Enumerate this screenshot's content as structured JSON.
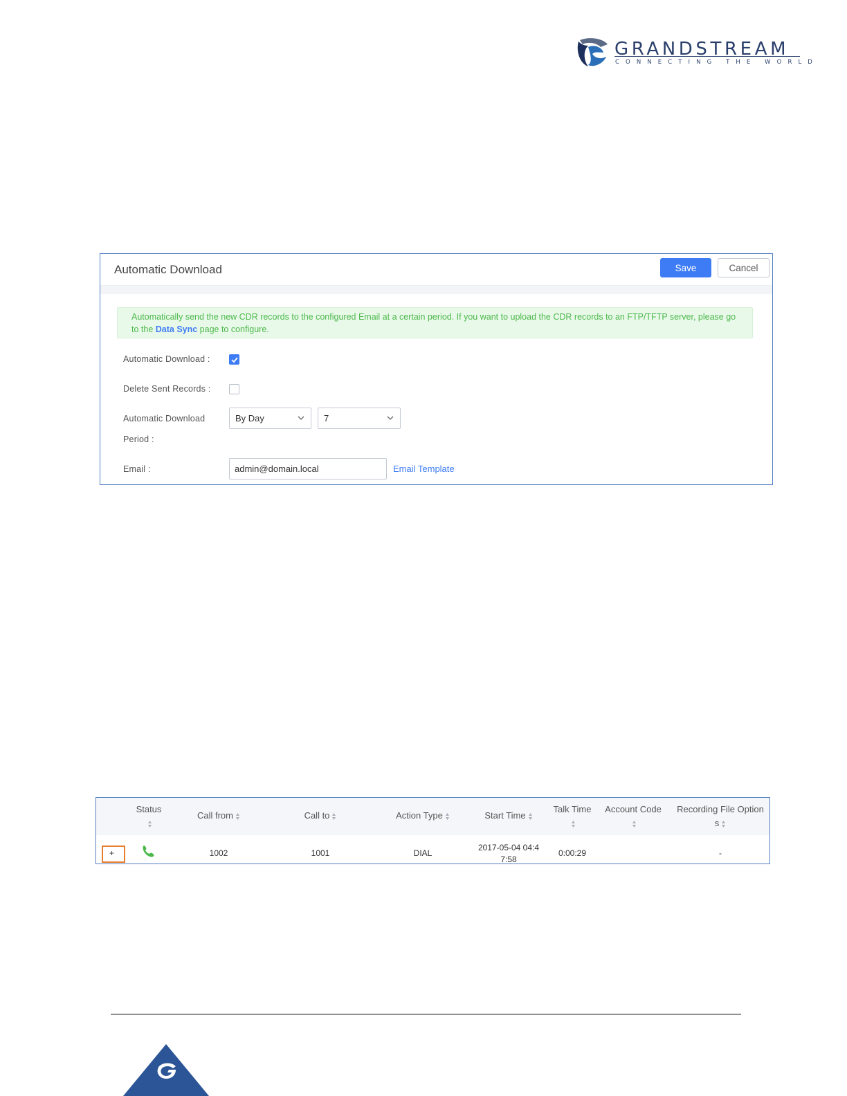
{
  "brand": {
    "name": "GRANDSTREAM",
    "tagline": "CONNECTING THE WORLD"
  },
  "auto_download": {
    "title": "Automatic Download",
    "save_label": "Save",
    "cancel_label": "Cancel",
    "notice_text_1": "Automatically send the new CDR records to the configured Email at a certain period. If you want to upload the CDR records to an FTP/TFTP server, please go to the ",
    "notice_link": "Data Sync",
    "notice_text_2": " page to configure.",
    "fields": {
      "automatic_download_label": "Automatic Download :",
      "automatic_download_checked": true,
      "delete_sent_label": "Delete Sent Records :",
      "delete_sent_checked": false,
      "period_label_1": "Automatic Download",
      "period_label_2": "Period :",
      "period_unit": "By Day",
      "period_value": "7",
      "email_label": "Email :",
      "email_value": "admin@domain.local",
      "email_template_link": "Email Template"
    }
  },
  "cdr_table": {
    "headers": {
      "status": "Status",
      "call_from": "Call from",
      "call_to": "Call to",
      "action_type": "Action Type",
      "start_time": "Start Time",
      "talk_time": "Talk Time",
      "account_code": "Account Code",
      "recording_1": "Recording File Option",
      "recording_2": "s"
    },
    "rows": [
      {
        "expand": "+",
        "call_from": "1002",
        "call_to": "1001",
        "action_type": "DIAL",
        "start_time_1": "2017-05-04 04:4",
        "start_time_2": "7:58",
        "talk_time": "0:00:29",
        "account_code": "",
        "recording": "-"
      }
    ]
  },
  "colors": {
    "accent": "#3d7cf5",
    "panel_border": "#4f7ec2",
    "notice_text": "#4cb84c",
    "highlight": "#e87d2c",
    "brand": "#2b3f6c"
  }
}
